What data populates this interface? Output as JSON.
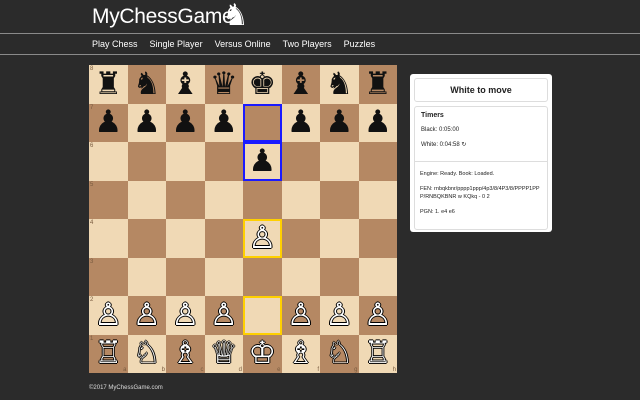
{
  "header": {
    "logo_text": "MyChessGame",
    "logo_icon": "knight-icon"
  },
  "nav": {
    "items": [
      "Play Chess",
      "Single Player",
      "Versus Online",
      "Two Players",
      "Puzzles"
    ]
  },
  "board": {
    "ranks": [
      "8",
      "7",
      "6",
      "5",
      "4",
      "3",
      "2",
      "1"
    ],
    "files": [
      "a",
      "b",
      "c",
      "d",
      "e",
      "f",
      "g",
      "h"
    ],
    "rows": [
      [
        "♜",
        "♞",
        "♝",
        "♛",
        "♚",
        "♝",
        "♞",
        "♜"
      ],
      [
        "♟",
        "♟",
        "♟",
        "♟",
        "",
        "♟",
        "♟",
        "♟"
      ],
      [
        "",
        "",
        "",
        "",
        "♟",
        "",
        "",
        ""
      ],
      [
        "",
        "",
        "",
        "",
        "",
        "",
        "",
        ""
      ],
      [
        "",
        "",
        "",
        "",
        "♙",
        "",
        "",
        ""
      ],
      [
        "",
        "",
        "",
        "",
        "",
        "",
        "",
        ""
      ],
      [
        "♙",
        "♙",
        "♙",
        "♙",
        "",
        "♙",
        "♙",
        "♙"
      ],
      [
        "♖",
        "♘",
        "♗",
        "♕",
        "♔",
        "♗",
        "♘",
        "♖"
      ]
    ],
    "colors": [
      [
        "b",
        "b",
        "b",
        "b",
        "b",
        "b",
        "b",
        "b"
      ],
      [
        "b",
        "b",
        "b",
        "b",
        "",
        "b",
        "b",
        "b"
      ],
      [
        "",
        "",
        "",
        "",
        "b",
        "",
        "",
        ""
      ],
      [
        "",
        "",
        "",
        "",
        "",
        "",
        "",
        ""
      ],
      [
        "",
        "",
        "",
        "",
        "w",
        "",
        "",
        ""
      ],
      [
        "",
        "",
        "",
        "",
        "",
        "",
        "",
        ""
      ],
      [
        "w",
        "w",
        "w",
        "w",
        "",
        "w",
        "w",
        "w"
      ],
      [
        "w",
        "w",
        "w",
        "w",
        "w",
        "w",
        "w",
        "w"
      ]
    ],
    "highlights": {
      "blue": [
        [
          1,
          4
        ],
        [
          2,
          4
        ]
      ],
      "yellow": [
        [
          4,
          4
        ],
        [
          6,
          4
        ]
      ]
    },
    "light_color": "#f0d9b5",
    "dark_color": "#b58863",
    "blue_highlight": "#1a1aff",
    "yellow_highlight": "#ffd000"
  },
  "panel": {
    "status": "White to move",
    "timers_title": "Timers",
    "black_time": "Black: 0:05:00",
    "white_time": "White: 0:04:58 ↻",
    "engine": "Engine: Ready. Book: Loaded.",
    "fen": "FEN: rnbqkbnr/pppp1ppp/4p3/8/4P3/8/PPPP1PPP/RNBQKBNR w KQkq - 0 2",
    "pgn": "PGN: 1. e4 e6"
  },
  "footer": {
    "copyright": "©2017 MyChessGame.com"
  }
}
